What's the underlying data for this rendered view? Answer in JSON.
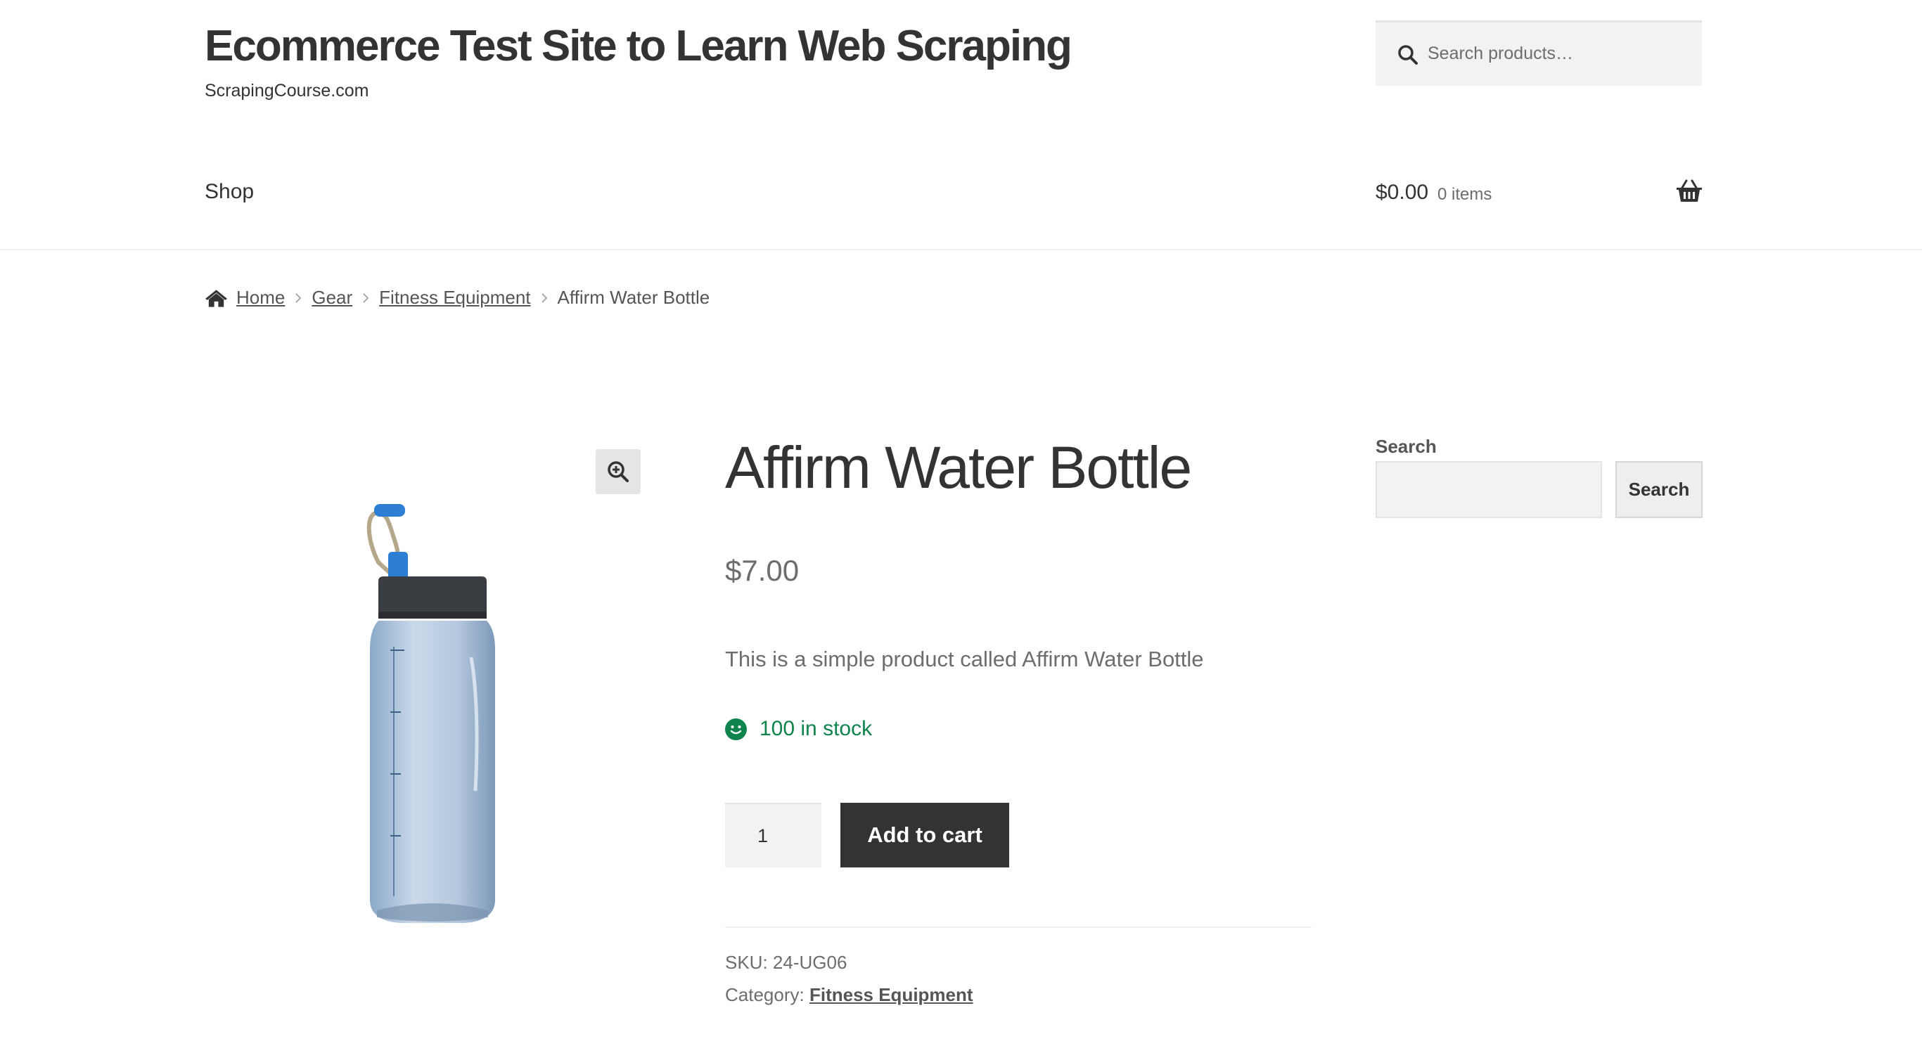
{
  "header": {
    "site_title": "Ecommerce Test Site to Learn Web Scraping",
    "tagline": "ScrapingCourse.com",
    "search_placeholder": "Search products…"
  },
  "nav": {
    "shop_label": "Shop"
  },
  "cart": {
    "amount": "$0.00",
    "count_label": "0 items"
  },
  "breadcrumb": {
    "items": [
      "Home",
      "Gear",
      "Fitness Equipment"
    ],
    "current": "Affirm Water Bottle"
  },
  "product": {
    "title": "Affirm Water Bottle",
    "price": "$7.00",
    "description": "This is a simple product called Affirm Water Bottle",
    "stock": "100 in stock",
    "quantity": "1",
    "add_to_cart_label": "Add to cart",
    "sku_label": "SKU:",
    "sku_value": "24-UG06",
    "category_label": "Category:",
    "category_value": "Fitness Equipment"
  },
  "sidebar": {
    "search_label": "Search",
    "search_button": "Search"
  },
  "icons": [
    "search-icon",
    "cart-basket-icon",
    "home-icon",
    "chevron-right-icon",
    "zoom-in-icon",
    "smile-icon"
  ],
  "colors": {
    "accent_stock": "#0f834d",
    "button_dark": "#333333",
    "text": "#404040"
  }
}
